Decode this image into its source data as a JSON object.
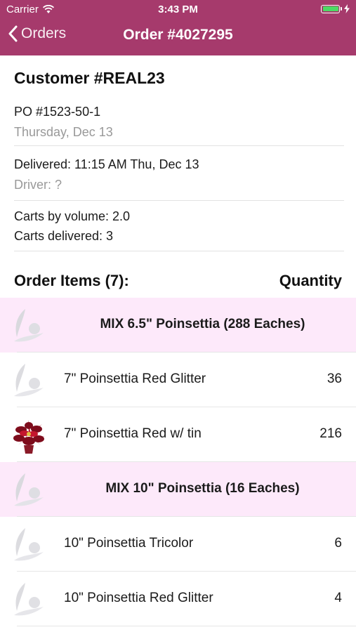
{
  "status_bar": {
    "carrier": "Carrier",
    "time": "3:43 PM"
  },
  "nav": {
    "back_label": "Orders",
    "title": "Order #4027295"
  },
  "customer": {
    "title": "Customer #REAL23",
    "po": "PO #1523-50-1",
    "date": "Thursday, Dec 13",
    "delivered": "Delivered: 11:15 AM Thu, Dec 13",
    "driver": "Driver: ?",
    "carts_volume": "Carts by volume: 2.0",
    "carts_delivered": "Carts delivered: 3"
  },
  "items_header": {
    "title": "Order Items (7):",
    "quantity": "Quantity"
  },
  "items": [
    {
      "label": "MIX 6.5\" Poinsettia (288 Eaches)",
      "qty": "",
      "group": true,
      "icon": "placeholder-plant-icon"
    },
    {
      "label": "7\" Poinsettia Red Glitter",
      "qty": "36",
      "group": false,
      "icon": "placeholder-plant-icon"
    },
    {
      "label": "7\" Poinsettia Red w/ tin",
      "qty": "216",
      "group": false,
      "icon": "poinsettia-photo"
    },
    {
      "label": "MIX 10\" Poinsettia (16 Eaches)",
      "qty": "",
      "group": true,
      "icon": "placeholder-plant-icon"
    },
    {
      "label": "10\" Poinsettia Tricolor",
      "qty": "6",
      "group": false,
      "icon": "placeholder-plant-icon"
    },
    {
      "label": "10\" Poinsettia Red Glitter",
      "qty": "4",
      "group": false,
      "icon": "placeholder-plant-icon"
    }
  ],
  "colors": {
    "nav_bar": "#a63a6c",
    "group_row": "#fde9fa",
    "battery": "#4cd964"
  }
}
